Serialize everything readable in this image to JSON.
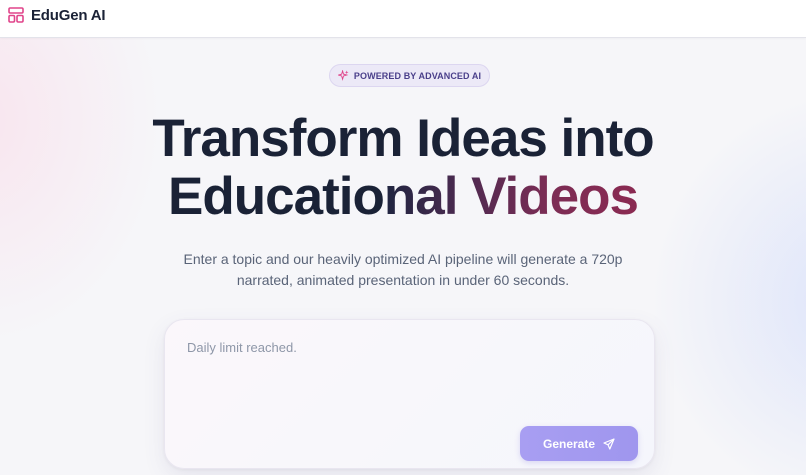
{
  "header": {
    "brand_name": "EduGen AI",
    "brand_icon": "layout-grid-icon"
  },
  "hero": {
    "badge_icon": "sparkles-icon",
    "badge_text": "POWERED BY ADVANCED AI",
    "title_line1": "Transform Ideas into",
    "title_line2_plain": "Educatio",
    "title_line2_gradient": "nal Videos",
    "subtitle_line1": "Enter a topic and our heavily optimized AI pipeline will generate a 720p",
    "subtitle_line2": "narrated, animated presentation in under 60 seconds."
  },
  "prompt_card": {
    "placeholder": "Daily limit reached.",
    "value": "",
    "generate_label": "Generate",
    "generate_icon": "send-icon"
  },
  "colors": {
    "brand_icon": "#e0448a",
    "accent_button": "#a49bf0",
    "title_dark": "#1a2236",
    "title_gradient_end": "#8b2a52"
  }
}
